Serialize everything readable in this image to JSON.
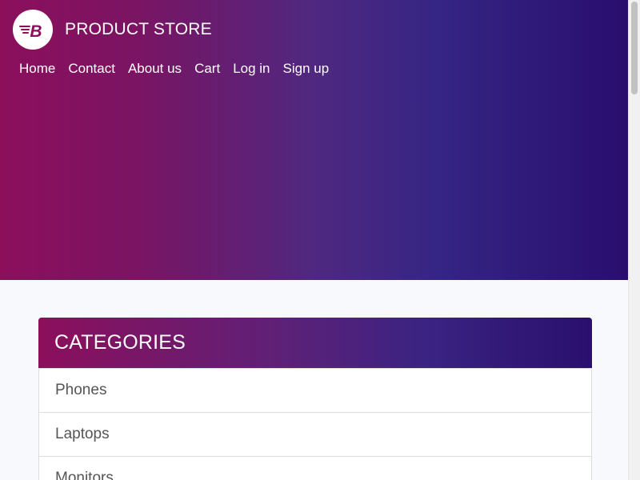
{
  "brand": {
    "name": "PRODUCT STORE",
    "logo_letter": "B",
    "logo_icon": "brand-b-logo-icon"
  },
  "nav": {
    "items": [
      "Home",
      "Contact",
      "About us",
      "Cart",
      "Log in",
      "Sign up"
    ]
  },
  "categories": {
    "title": "CATEGORIES",
    "items": [
      "Phones",
      "Laptops",
      "Monitors"
    ]
  },
  "colors": {
    "gradient_start": "#8c0f5c",
    "gradient_end": "#290e6e",
    "page_background": "#f8f9fc",
    "category_text": "#555555"
  }
}
